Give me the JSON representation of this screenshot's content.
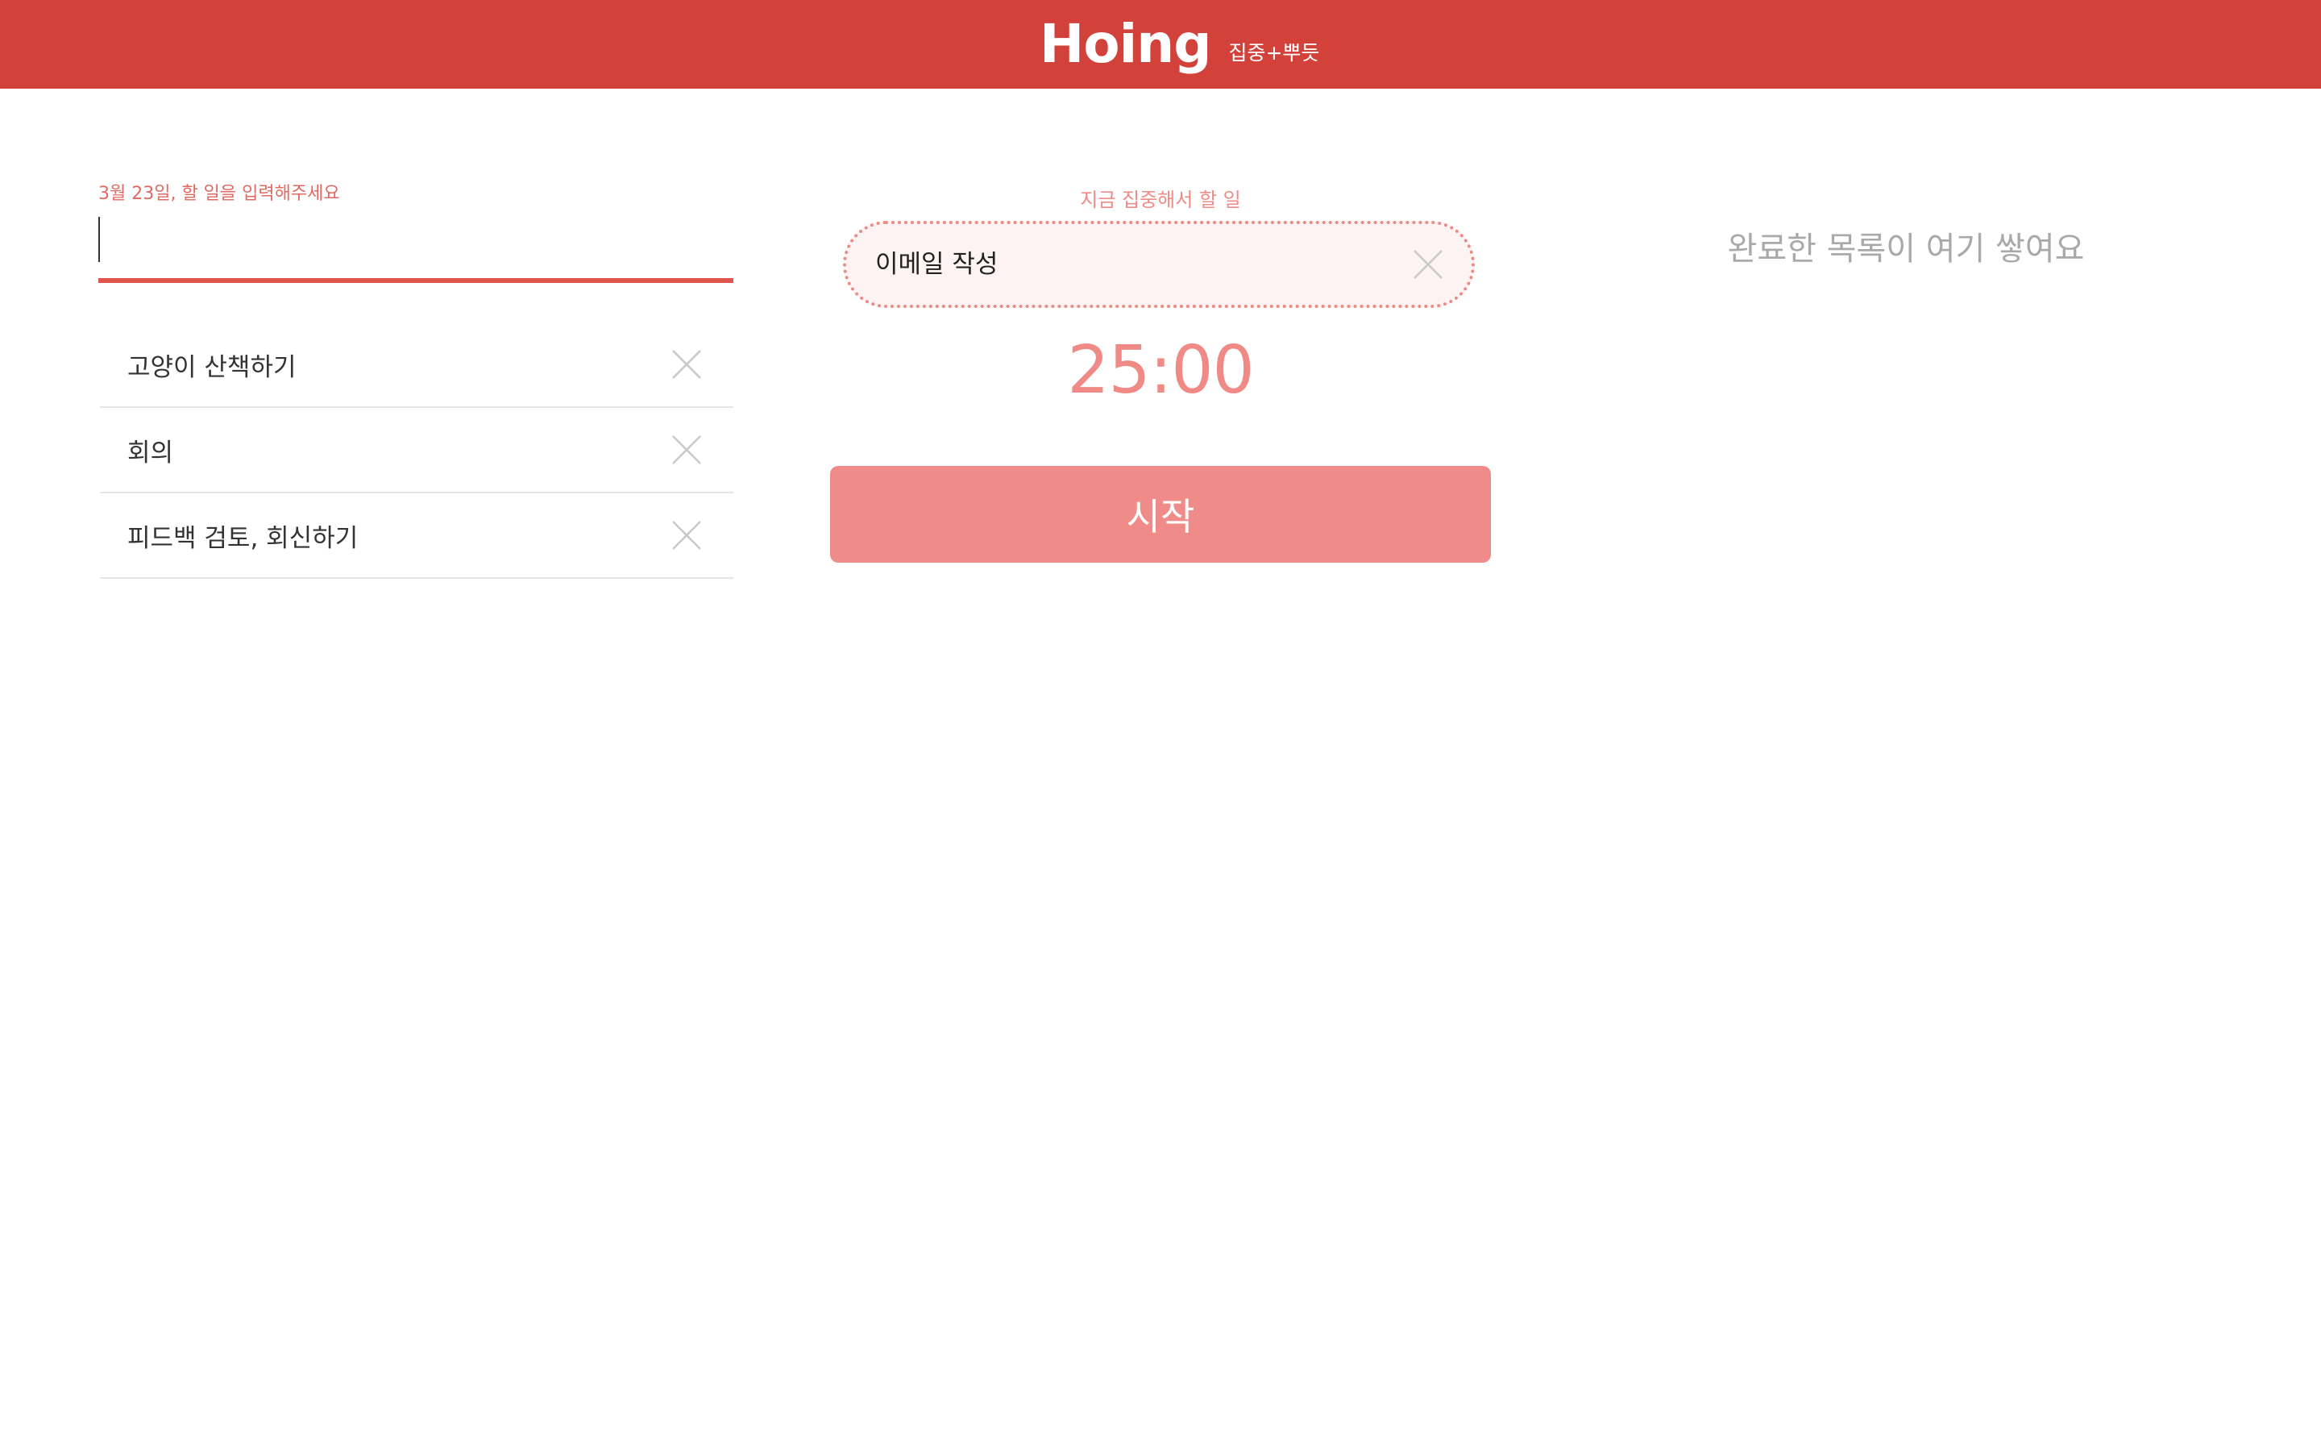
{
  "header": {
    "logo": "Hoing",
    "tagline": "집중+뿌듯",
    "bg_color": "#d2413a"
  },
  "input": {
    "label": "3월 23일, 할 일을 입력해주세요",
    "value": "",
    "placeholder": ""
  },
  "todos": {
    "items": [
      {
        "text": "고양이 산책하기",
        "remove_icon": "close-icon"
      },
      {
        "text": "회의",
        "remove_icon": "close-icon"
      },
      {
        "text": "피드백 검토, 회신하기",
        "remove_icon": "close-icon"
      }
    ]
  },
  "focus": {
    "label": "지금 집중해서 할 일",
    "task": "이메일 작성",
    "remove_icon": "close-icon",
    "timer": "25:00",
    "start_label": "시작",
    "accent_color": "#ef8c89"
  },
  "done": {
    "placeholder": "완료한 목록이 여기 쌓여요"
  }
}
